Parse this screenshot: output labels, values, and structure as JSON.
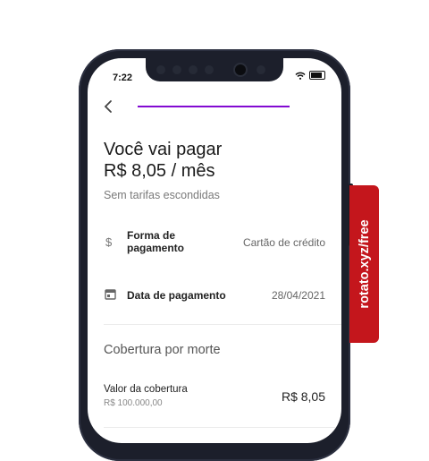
{
  "status_bar": {
    "time": "7:22"
  },
  "header": {
    "back_icon": "chevron-left-icon"
  },
  "summary": {
    "title_line1": "Você vai pagar",
    "title_line2": "R$ 8,05 / mês",
    "subtitle": "Sem tarifas escondidas"
  },
  "details": {
    "payment_method_icon": "dollar-icon",
    "payment_method_label_line1": "Forma de",
    "payment_method_label_line2": "pagamento",
    "payment_method_value": "Cartão de crédito",
    "payment_date_icon": "calendar-icon",
    "payment_date_label": "Data de pagamento",
    "payment_date_value": "28/04/2021"
  },
  "coverage": {
    "section_title": "Cobertura por morte",
    "label": "Valor da cobertura",
    "amount": "R$ 100.000,00",
    "price": "R$ 8,05"
  },
  "badge": {
    "text": "rotato.xyz/free"
  },
  "colors": {
    "accent": "#820ad1",
    "badge": "#c4161c",
    "phone_frame": "#1c1f2b"
  }
}
